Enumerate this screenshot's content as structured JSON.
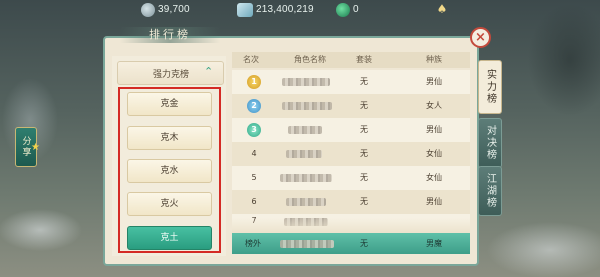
{
  "topbar": {
    "resources": [
      {
        "icon": "silver-coin-icon",
        "value": "39,700"
      },
      {
        "icon": "ingot-icon",
        "value": "213,400,219"
      },
      {
        "icon": "jade-icon",
        "value": "0"
      }
    ],
    "bell_icon": "bell-icon"
  },
  "side": {
    "share_label": "分享"
  },
  "panel": {
    "title": "排行榜",
    "category_header": "强力克榜",
    "sub_categories": [
      "克金",
      "克木",
      "克水",
      "克火",
      "克土"
    ],
    "active_sub": "克土",
    "columns": [
      "名次",
      "角色名称",
      "套装",
      "种族"
    ],
    "rows": [
      {
        "rank": "1",
        "set": "无",
        "race": "男仙"
      },
      {
        "rank": "2",
        "set": "无",
        "race": "女人"
      },
      {
        "rank": "3",
        "set": "无",
        "race": "男仙"
      },
      {
        "rank": "4",
        "set": "无",
        "race": "女仙"
      },
      {
        "rank": "5",
        "set": "无",
        "race": "女仙"
      },
      {
        "rank": "6",
        "set": "无",
        "race": "男仙"
      },
      {
        "rank": "7",
        "set": "",
        "race": ""
      }
    ],
    "self_row": {
      "rank": "榜外",
      "set": "无",
      "race": "男魔"
    },
    "tabs": [
      "实力榜",
      "对决榜",
      "江湖榜"
    ],
    "active_tab": "实力榜"
  },
  "colors": {
    "accent": "#3aa587",
    "highlight_frame": "#d42a24",
    "close": "#c34a3c"
  }
}
